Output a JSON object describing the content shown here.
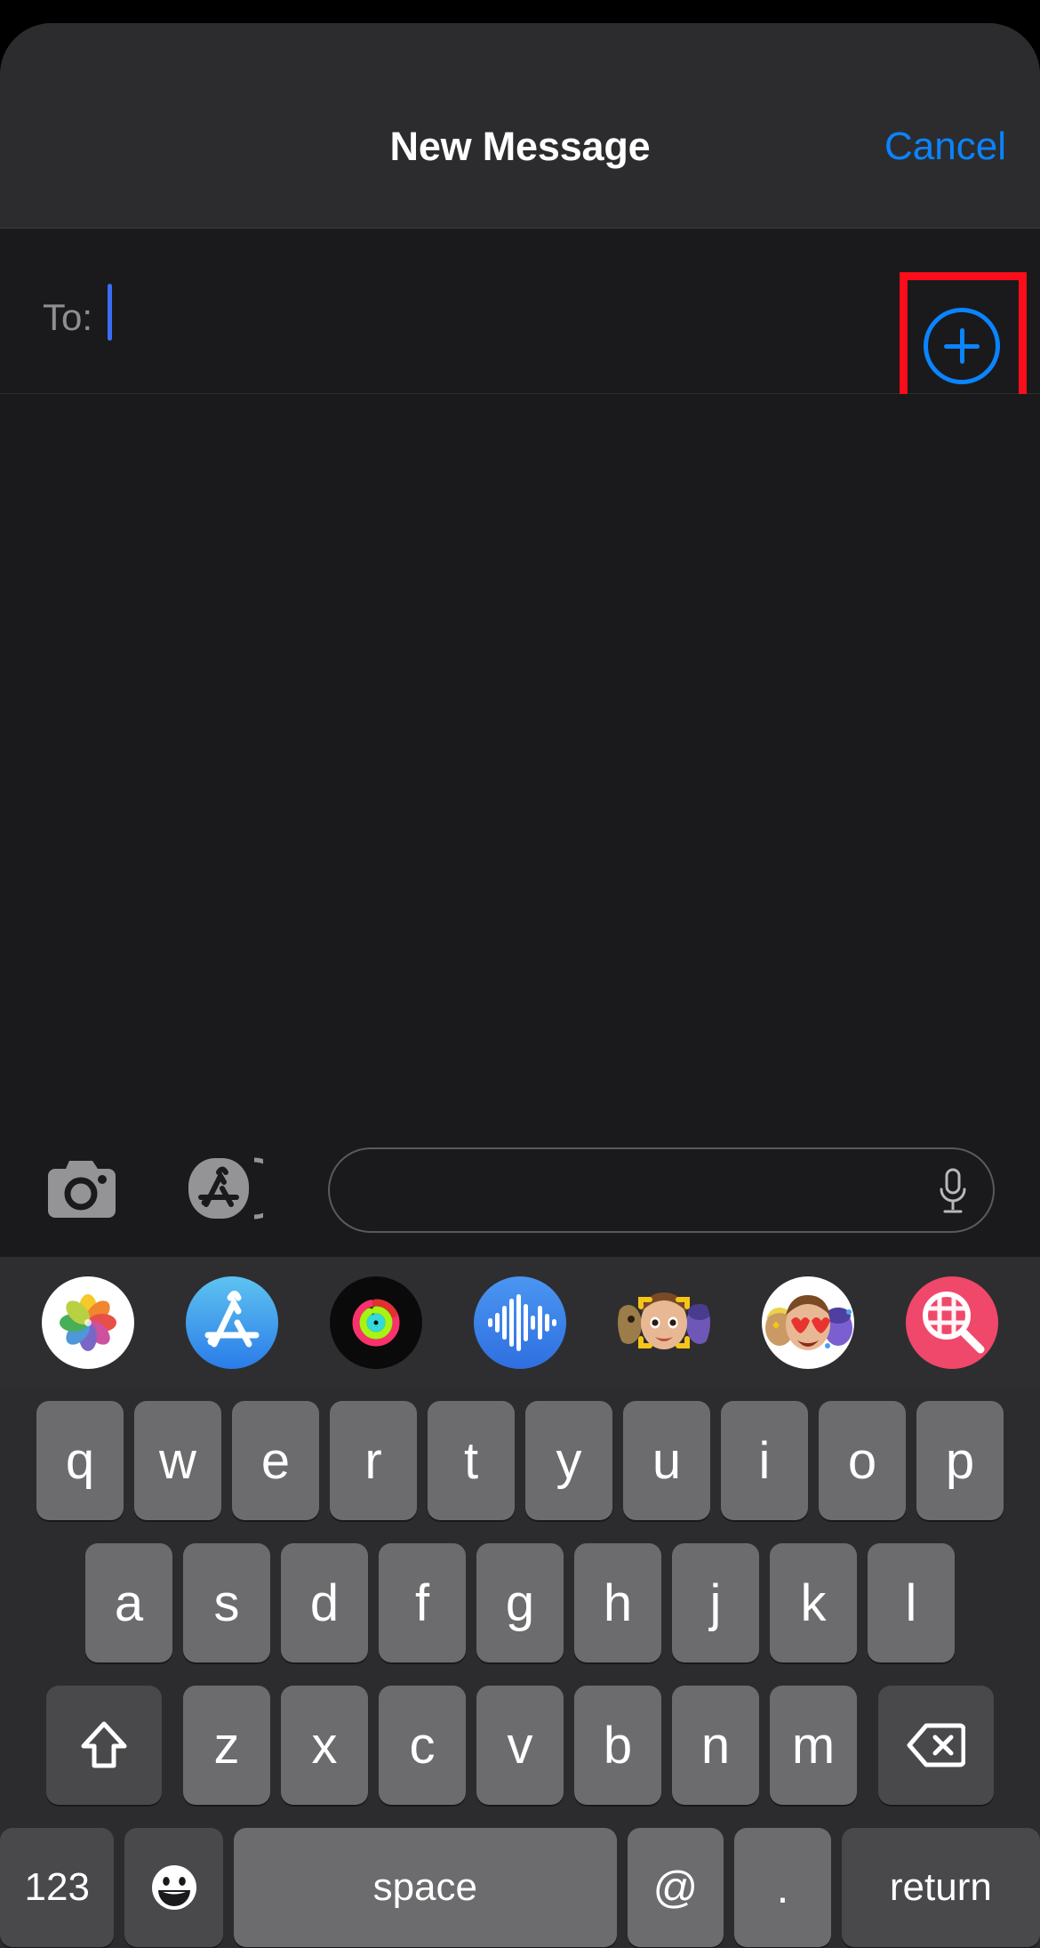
{
  "app": {
    "name": "Messages",
    "platform": "iOS",
    "appearance": "dark"
  },
  "colors": {
    "accent_blue": "#0a84ff",
    "caret_blue": "#3b6ef5",
    "highlight_red": "#fb0d1b",
    "navbar_bg": "#2c2c2e",
    "sheet_bg": "#1a1a1c",
    "keyboard_bg": "#2c2c2e",
    "key_bg": "#6c6c6e",
    "key_dark_bg": "#49494b",
    "label_gray": "#8e8e93"
  },
  "navbar": {
    "title": "New Message",
    "cancel_label": "Cancel"
  },
  "recipients": {
    "to_label": "To:",
    "value": "",
    "placeholder": "",
    "caret_visible": true,
    "add_contact_icon": "plus-circle-icon",
    "add_contact_highlighted": true
  },
  "compose": {
    "camera_icon": "camera-icon",
    "appstore_icon": "app-store-icon",
    "message_value": "",
    "message_placeholder": "",
    "mic_icon": "microphone-icon"
  },
  "app_drawer": {
    "items": [
      {
        "name": "Photos",
        "icon": "photos-icon"
      },
      {
        "name": "App Store",
        "icon": "app-store-icon"
      },
      {
        "name": "Fitness",
        "icon": "activity-rings-icon"
      },
      {
        "name": "Audio",
        "icon": "audio-waveform-icon"
      },
      {
        "name": "Memoji",
        "icon": "memoji-icon"
      },
      {
        "name": "Memoji Stickers",
        "icon": "memoji-stickers-icon"
      },
      {
        "name": "#images",
        "icon": "images-search-icon"
      }
    ]
  },
  "keyboard": {
    "type": "email-qwerty",
    "row1": [
      "q",
      "w",
      "e",
      "r",
      "t",
      "y",
      "u",
      "i",
      "o",
      "p"
    ],
    "row2": [
      "a",
      "s",
      "d",
      "f",
      "g",
      "h",
      "j",
      "k",
      "l"
    ],
    "row3_letters": [
      "z",
      "x",
      "c",
      "v",
      "b",
      "n",
      "m"
    ],
    "shift_label": "shift",
    "shift_icon": "shift-arrow-icon",
    "delete_label": "delete",
    "delete_icon": "backspace-icon",
    "numeric_label": "123",
    "emoji_label": "emoji",
    "emoji_icon": "smiley-face-icon",
    "space_label": "space",
    "at_label": "@",
    "period_label": ".",
    "return_label": "return"
  }
}
